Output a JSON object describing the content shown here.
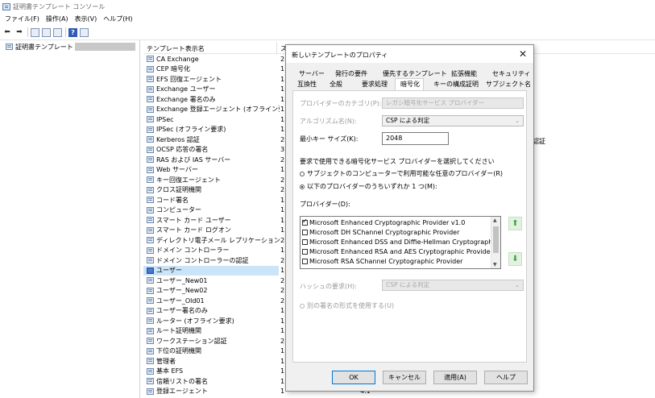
{
  "window": {
    "title": "証明書テンプレート コンソール"
  },
  "menu": [
    "ファイル(F)",
    "操作(A)",
    "表示(V)",
    "ヘルプ(H)"
  ],
  "toolbar": {
    "back": "back-arrow",
    "forward": "forward-arrow",
    "help_label": "?"
  },
  "tree": {
    "root_label": "証明書テンプレート"
  },
  "list": {
    "column_name": "テンプレート表示名",
    "column_version_partial": "ス",
    "rows": [
      {
        "name": "CA Exchange",
        "ver": "2"
      },
      {
        "name": "CEP 暗号化",
        "ver": "1"
      },
      {
        "name": "EFS 回復エージェント",
        "ver": "1"
      },
      {
        "name": "Exchange ユーザー",
        "ver": "1"
      },
      {
        "name": "Exchange 署名のみ",
        "ver": "1"
      },
      {
        "name": "Exchange 登録エージェント (オフライン要求)",
        "ver": "1"
      },
      {
        "name": "IPSec",
        "ver": "1"
      },
      {
        "name": "IPSec (オフライン要求)",
        "ver": "1"
      },
      {
        "name": "Kerberos 認証",
        "ver": "2"
      },
      {
        "name": "OCSP 応答の署名",
        "ver": "3"
      },
      {
        "name": "RAS および IAS サーバー",
        "ver": "2"
      },
      {
        "name": "Web サーバー",
        "ver": "1"
      },
      {
        "name": "キー回復エージェント",
        "ver": "2"
      },
      {
        "name": "クロス証明機関",
        "ver": "2"
      },
      {
        "name": "コード署名",
        "ver": "1"
      },
      {
        "name": "コンピューター",
        "ver": "1"
      },
      {
        "name": "スマート カード ユーザー",
        "ver": "1"
      },
      {
        "name": "スマート カード ログオン",
        "ver": "1"
      },
      {
        "name": "ディレクトリ電子メール レプリケーション",
        "ver": "2"
      },
      {
        "name": "ドメイン コントローラー",
        "ver": "1"
      },
      {
        "name": "ドメイン コントローラーの認証",
        "ver": "2"
      },
      {
        "name": "ユーザー",
        "ver": "1"
      },
      {
        "name": "ユーザー_New01",
        "ver": "2"
      },
      {
        "name": "ユーザー_New02",
        "ver": "2"
      },
      {
        "name": "ユーザー_Old01",
        "ver": "2"
      },
      {
        "name": "ユーザー署名のみ",
        "ver": "1"
      },
      {
        "name": "ルーター (オフライン要求)",
        "ver": "1"
      },
      {
        "name": "ルート証明機関",
        "ver": "1"
      },
      {
        "name": "ワークステーション認証",
        "ver": "2"
      },
      {
        "name": "下位の証明機関",
        "ver": "1"
      },
      {
        "name": "管理者",
        "ver": "1"
      },
      {
        "name": "基本 EFS",
        "ver": "1"
      },
      {
        "name": "信頼リストの署名",
        "ver": "1"
      },
      {
        "name": "登録エージェント",
        "ver": "1"
      }
    ],
    "selected_index": 21,
    "stray_right_text": "認証",
    "stray_bottom_text": "4.1"
  },
  "dialog": {
    "title": "新しいテンプレートのプロパティ",
    "close_glyph": "✕",
    "tabs_row1": [
      "サーバー",
      "発行の要件",
      "優先するテンプレート",
      "拡張機能",
      "セキュリティ"
    ],
    "tabs_row2": [
      "互換性",
      "全般",
      "要求処理",
      "暗号化",
      "キーの構成証明",
      "サブジェクト名"
    ],
    "active_tab": "暗号化",
    "provider_category_label": "プロバイダーのカテゴリ(P):",
    "provider_category_value": "レガシ暗号化サービス プロバイダー",
    "algorithm_label": "アルゴリズム名(N):",
    "algorithm_value": "CSP による判定",
    "min_key_label": "最小キー サイズ(K):",
    "min_key_value": "2048",
    "select_csp_text": "要求で使用できる暗号化サービス プロバイダーを選択してください",
    "radio_any": "サブジェクトのコンピューターで利用可能な任意のプロバイダー(R)",
    "radio_following": "以下のプロバイダーのうちいずれか 1 つ(M):",
    "providers_label": "プロバイダー(D):",
    "providers": [
      {
        "name": "Microsoft Enhanced Cryptographic Provider v1.0",
        "checked": true
      },
      {
        "name": "Microsoft DH SChannel Cryptographic Provider",
        "checked": false
      },
      {
        "name": "Microsoft Enhanced DSS and Diffie-Hellman Cryptographic Provi",
        "checked": false
      },
      {
        "name": "Microsoft Enhanced RSA and AES Cryptographic Provider",
        "checked": false
      },
      {
        "name": "Microsoft RSA SChannel Cryptographic Provider",
        "checked": false
      }
    ],
    "hash_label": "ハッシュの要求(H):",
    "hash_value": "CSP による判定",
    "alt_sig_label": "別の署名の形式を使用する(U)",
    "buttons": {
      "ok": "OK",
      "cancel": "キャンセル",
      "apply": "適用(A)",
      "help": "ヘルプ"
    }
  }
}
